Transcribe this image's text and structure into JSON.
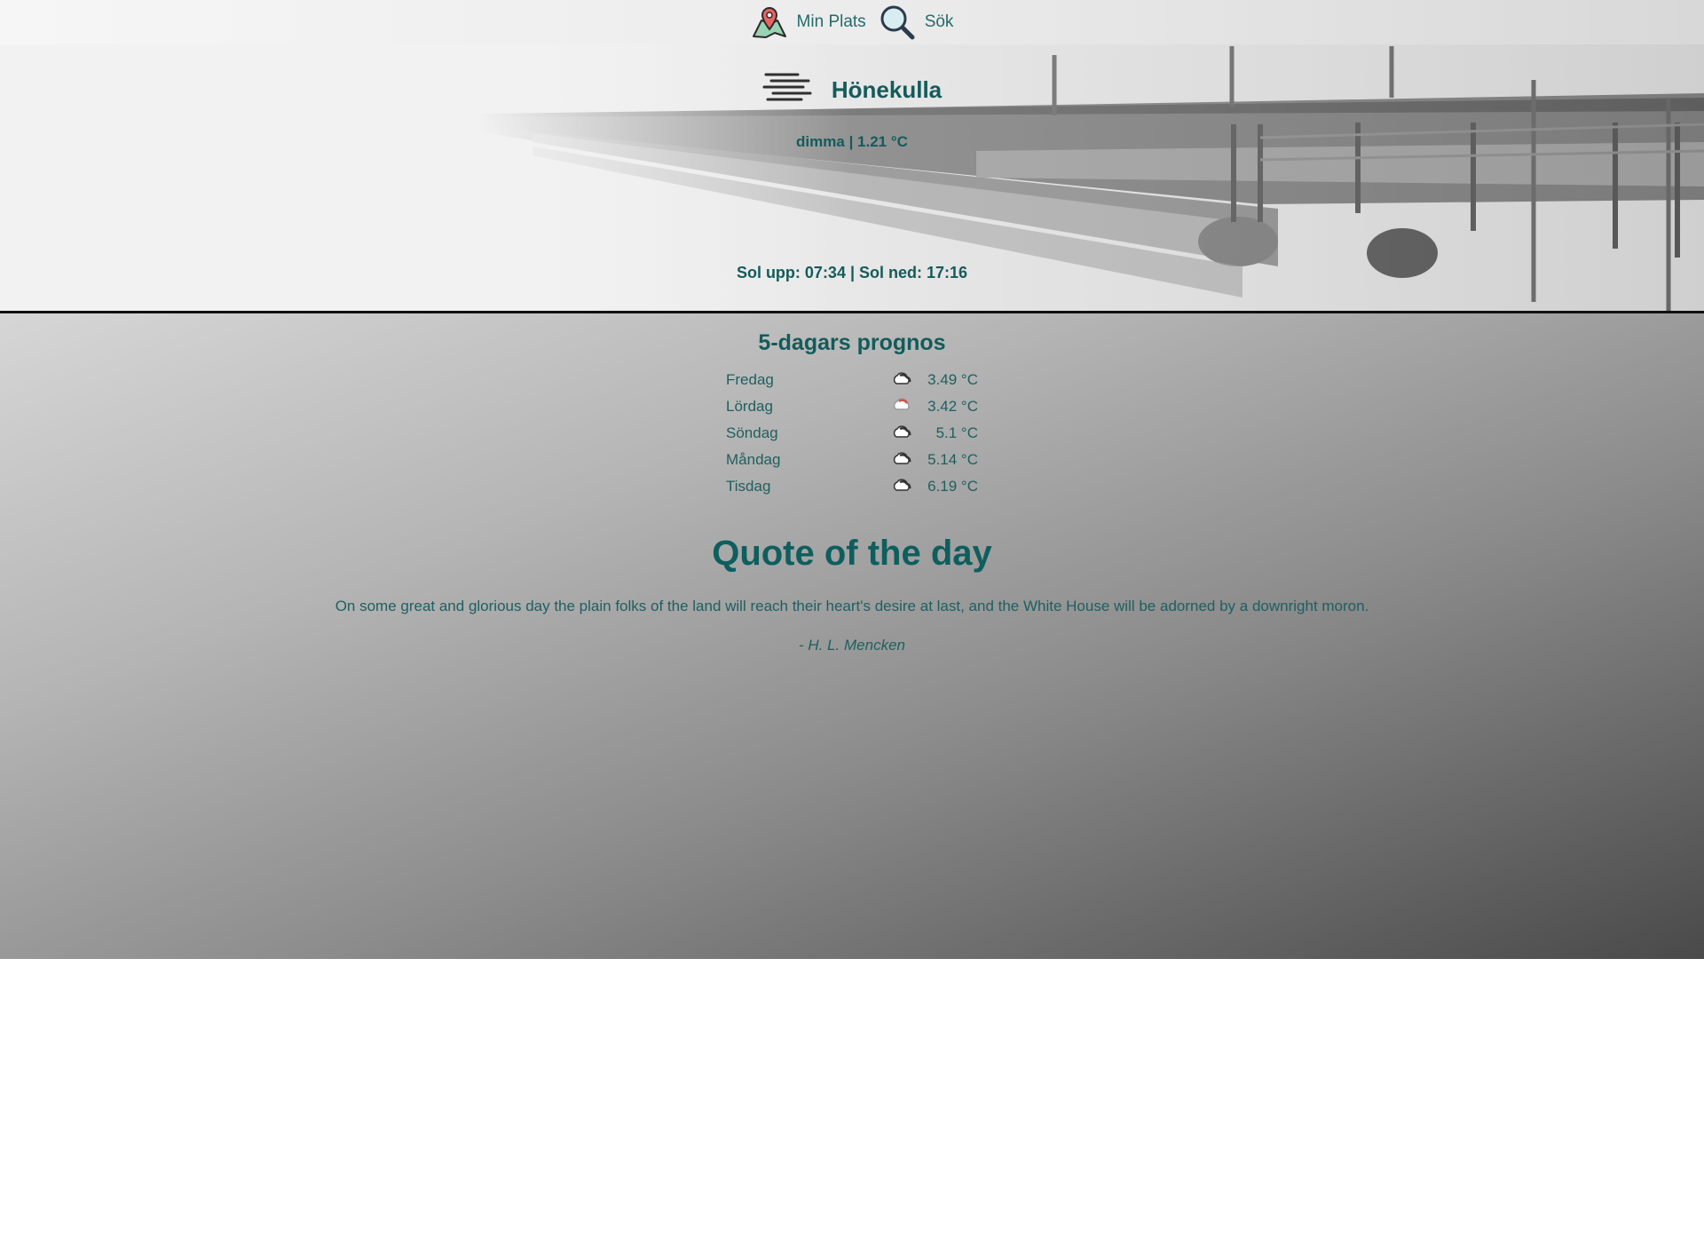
{
  "nav": {
    "location_label": "Min Plats",
    "search_label": "Sök"
  },
  "weather": {
    "city": "Hönekulla",
    "conditions": "dimma | 1.21 °C",
    "sun": "Sol upp: 07:34 |  Sol ned: 17:16"
  },
  "forecast": {
    "title": "5-dagars prognos",
    "days": [
      {
        "day": "Fredag",
        "icon": "cloud-icon",
        "temp": "3.49 °C"
      },
      {
        "day": "Lördag",
        "icon": "cloud-rain-icon",
        "temp": "3.42 °C"
      },
      {
        "day": "Söndag",
        "icon": "cloud-icon",
        "temp": "5.1 °C"
      },
      {
        "day": "Måndag",
        "icon": "cloud-icon",
        "temp": "5.14 °C"
      },
      {
        "day": "Tisdag",
        "icon": "cloud-icon",
        "temp": "6.19 °C"
      }
    ]
  },
  "quote": {
    "title": "Quote of the day",
    "text": "On some great and glorious day the plain folks of the land will reach their heart's desire at last, and the White House will be adorned by a downright moron.",
    "author": "- H. L. Mencken"
  }
}
